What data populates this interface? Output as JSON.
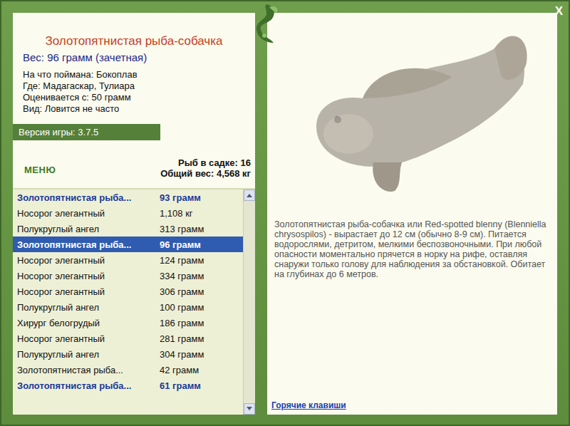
{
  "close_button": "X",
  "fish": {
    "title": "Золотопятнистая рыба-собачка",
    "weight": "Вес: 96 грамм (зачетная)",
    "details": [
      "На что поймана: Бокоплав",
      "Где: Мадагаскар, Тулиара",
      "Оценивается с: 50 грамм",
      "Вид: Ловится не часто"
    ]
  },
  "version": "Версия игры: 3.7.5",
  "menu": "МЕНЮ",
  "summary": [
    "Рыб в садке: 16",
    "Общий вес: 4,568 кг"
  ],
  "catch_list": {
    "rows": [
      {
        "name": "Золотопятнистая рыба...",
        "weight": "93 грамм",
        "selected": false,
        "trophy": true
      },
      {
        "name": "Носорог элегантный",
        "weight": "1,108 кг",
        "selected": false,
        "trophy": false
      },
      {
        "name": "Полукруглый ангел",
        "weight": "313 грамм",
        "selected": false,
        "trophy": false
      },
      {
        "name": "Золотопятнистая рыба...",
        "weight": "96 грамм",
        "selected": true,
        "trophy": true
      },
      {
        "name": "Носорог элегантный",
        "weight": "124 грамм",
        "selected": false,
        "trophy": false
      },
      {
        "name": "Носорог элегантный",
        "weight": "334 грамм",
        "selected": false,
        "trophy": false
      },
      {
        "name": "Носорог элегантный",
        "weight": "306 грамм",
        "selected": false,
        "trophy": false
      },
      {
        "name": "Полукруглый ангел",
        "weight": "100 грамм",
        "selected": false,
        "trophy": false
      },
      {
        "name": "Хирург белогрудый",
        "weight": "186 грамм",
        "selected": false,
        "trophy": false
      },
      {
        "name": "Носорог элегантный",
        "weight": "281 грамм",
        "selected": false,
        "trophy": false
      },
      {
        "name": "Полукруглый ангел",
        "weight": "304 грамм",
        "selected": false,
        "trophy": false
      },
      {
        "name": "Золотопятнистая рыба...",
        "weight": "42 грамм",
        "selected": false,
        "trophy": false
      },
      {
        "name": "Золотопятнистая рыба...",
        "weight": "61 грамм",
        "selected": false,
        "trophy": true
      }
    ]
  },
  "description": "Золотопятнистая рыба-собачка или Red-spotted blenny (Blenniella chrysospilos) - вырастает до 12 см (обычно 8-9 см). Питается водорослями, детритом, мелкими беспозвоночными. При любой опасности моментально прячется в норку на рифе, оставляя снаружи только голову для наблюдения за обстановкой. Обитает на глубинах до 6 метров.",
  "hotkeys_link": "Горячие клавиши"
}
